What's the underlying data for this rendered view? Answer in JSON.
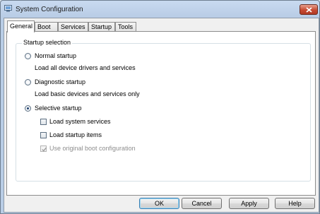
{
  "window": {
    "title": "System Configuration"
  },
  "tabs": [
    {
      "label": "General",
      "active": true
    },
    {
      "label": "Boot",
      "active": false
    },
    {
      "label": "Services",
      "active": false
    },
    {
      "label": "Startup",
      "active": false
    },
    {
      "label": "Tools",
      "active": false
    }
  ],
  "startup_selection": {
    "group_label": "Startup selection",
    "normal": {
      "label": "Normal startup",
      "description": "Load all device drivers and services",
      "selected": false
    },
    "diagnostic": {
      "label": "Diagnostic startup",
      "description": "Load basic devices and services only",
      "selected": false
    },
    "selective": {
      "label": "Selective startup",
      "selected": true
    },
    "options": {
      "load_system_services": {
        "label": "Load system services",
        "checked": false,
        "enabled": true
      },
      "load_startup_items": {
        "label": "Load startup items",
        "checked": false,
        "enabled": true
      },
      "use_original_boot": {
        "label": "Use original boot configuration",
        "checked": true,
        "enabled": false
      }
    }
  },
  "buttons": {
    "ok": "OK",
    "cancel": "Cancel",
    "apply": "Apply",
    "help": "Help"
  },
  "colors": {
    "titlebar": "#c9daf0",
    "close_button": "#c74a32",
    "default_button_border": "#3c7fb1"
  }
}
